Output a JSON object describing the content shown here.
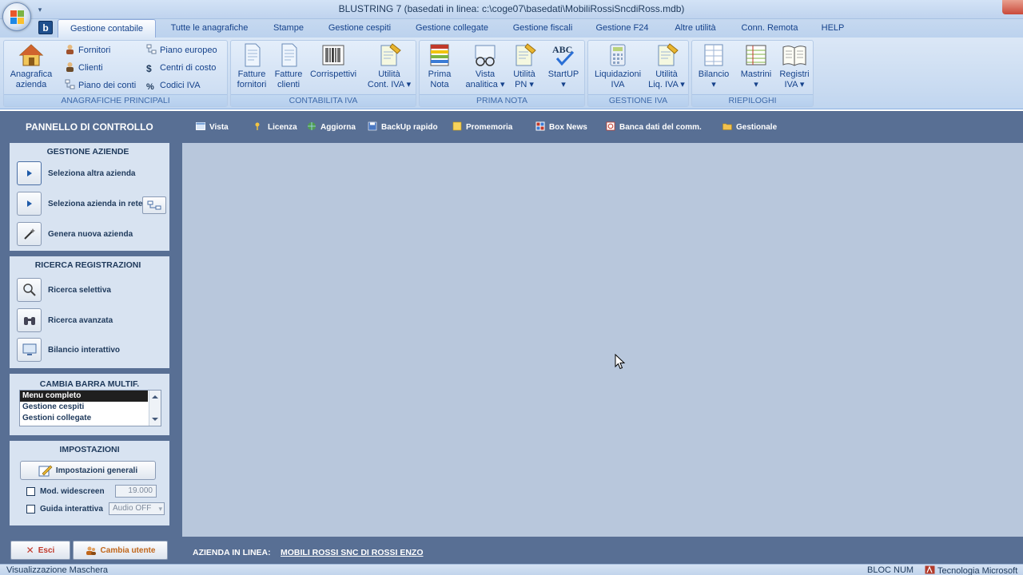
{
  "window": {
    "title": "BLUSTRING 7   (basedati in linea: c:\\coge07\\basedati\\MobiliRossiSncdiRoss.mdb)",
    "logo_text": "b"
  },
  "tabs": [
    {
      "label": "Gestione contabile",
      "active": true
    },
    {
      "label": "Tutte le anagrafiche"
    },
    {
      "label": "Stampe"
    },
    {
      "label": "Gestione cespiti"
    },
    {
      "label": "Gestione collegate"
    },
    {
      "label": "Gestione fiscali"
    },
    {
      "label": "Gestione F24"
    },
    {
      "label": "Altre utilità"
    },
    {
      "label": "Conn. Remota"
    },
    {
      "label": "HELP"
    }
  ],
  "ribbon": {
    "anagrafiche": {
      "label": "ANAGRAFICHE PRINCIPALI",
      "anagrafica_l1": "Anagrafica",
      "anagrafica_l2": "azienda",
      "fornitori": "Fornitori",
      "clienti": "Clienti",
      "piano_conti": "Piano dei conti",
      "piano_europeo": "Piano europeo",
      "centri_costo": "Centri di costo",
      "codici_iva": "Codici IVA"
    },
    "contabilita": {
      "label": "CONTABILITA IVA",
      "ff_l1": "Fatture",
      "ff_l2": "fornitori",
      "fc_l1": "Fatture",
      "fc_l2": "clienti",
      "corr_l1": "Corrispettivi",
      "ut_l1": "Utilità",
      "ut_l2": "Cont. IVA ▾"
    },
    "prima_nota": {
      "label": "PRIMA NOTA",
      "pn_l1": "Prima",
      "pn_l2": "Nota",
      "va_l1": "Vista",
      "va_l2": "analitica ▾",
      "upn_l1": "Utilità",
      "upn_l2": "PN ▾",
      "su_l1": "StartUP",
      "su_l2": "▾"
    },
    "gestione_iva": {
      "label": "GESTIONE IVA",
      "liq_l1": "Liquidazioni",
      "liq_l2": "IVA",
      "uliq_l1": "Utilità",
      "uliq_l2": "Liq. IVA ▾"
    },
    "riepiloghi": {
      "label": "RIEPILOGHI",
      "bil_l1": "Bilancio",
      "bil_l2": "▾",
      "mas_l1": "Mastrini",
      "mas_l2": "▾",
      "reg_l1": "Registri",
      "reg_l2": "IVA ▾"
    }
  },
  "toolbar": {
    "panel_title": "PANNELLO DI CONTROLLO",
    "vista": "Vista",
    "licenza": "Licenza",
    "aggiorna": "Aggiorna",
    "backup": "BackUp rapido",
    "promemoria": "Promemoria",
    "boxnews": "Box News",
    "banca": "Banca dati del comm.",
    "gestionale": "Gestionale"
  },
  "sidebar": {
    "aziende": {
      "title": "GESTIONE AZIENDE",
      "seleziona": "Seleziona altra azienda",
      "rete": "Seleziona azienda in rete",
      "genera": "Genera nuova azienda"
    },
    "ricerca": {
      "title": "RICERCA REGISTRAZIONI",
      "selettiva": "Ricerca selettiva",
      "avanzata": "Ricerca avanzata",
      "bilancio": "Bilancio interattivo"
    },
    "barra": {
      "title": "CAMBIA BARRA MULTIF.",
      "items": [
        "Menu completo",
        "Gestione cespiti",
        "Gestioni collegate"
      ],
      "selected": "Menu completo"
    },
    "impostazioni": {
      "title": "IMPOSTAZIONI",
      "button": "Impostazioni generali",
      "widescreen_label": "Mod. widescreen",
      "widescreen_value": "19.000",
      "guida_label": "Guida interattiva",
      "guida_value": "Audio OFF"
    }
  },
  "bottom": {
    "esci": "Esci",
    "cambia_utente": "Cambia utente",
    "azienda_label": "AZIENDA IN LINEA:",
    "azienda_value": "MOBILI ROSSI SNC DI ROSSI ENZO"
  },
  "status": {
    "left": "Visualizzazione Maschera",
    "num": "BLOC NUM",
    "tech": "Tecnologia Microsoft"
  },
  "colors": {
    "panel_dark": "#586f94",
    "main_area": "#b8c7dc",
    "box_bg": "#d8e3f1",
    "ribbon_text": "#15428b",
    "esci_accent": "#c0392b",
    "cambia_accent": "#c0661a"
  }
}
